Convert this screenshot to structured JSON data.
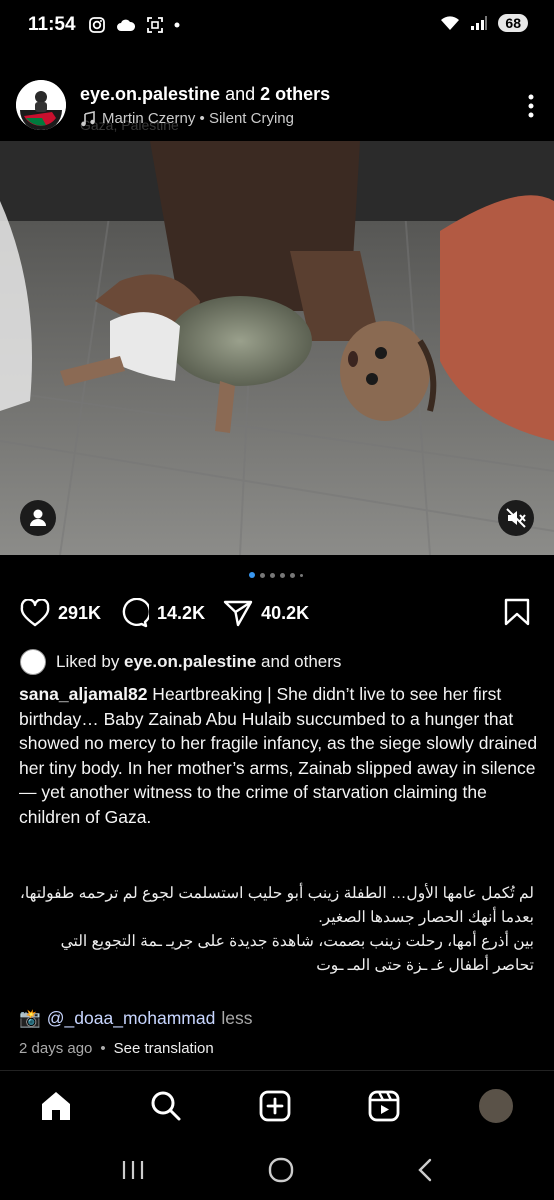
{
  "status_bar": {
    "time": "11:54",
    "battery": "68"
  },
  "post": {
    "author": "eye.on.palestine",
    "author_suffix": " and ",
    "others": "2 others",
    "music": "Martin Czerny • Silent Crying",
    "location": "Gaza, Palestine",
    "carousel_count": 6,
    "carousel_active": 0
  },
  "actions": {
    "likes": "291K",
    "comments": "14.2K",
    "shares": "40.2K"
  },
  "liked_by": {
    "prefix": "Liked by ",
    "user": "eye.on.palestine",
    "suffix": " and others"
  },
  "caption": {
    "username": "sana_aljamal82",
    "text": " Heartbreaking | She didn’t live to see her first birthday… Baby Zainab Abu Hulaib succumbed to a hunger that showed no mercy to her fragile infancy, as the siege slowly drained her tiny body. In her mother’s arms, Zainab slipped away in silence — yet another witness to the crime of starvation claiming the children of Gaza.",
    "arabic_1": "لم تُكمل عامها الأول… الطفلة زينب أبو حليب استسلمت لجوع لم ترحمه طفولتها، بعدما أنهك الحصار جسدها الصغير.",
    "arabic_2": "بين أذرع أمها، رحلت زينب بصمت، شاهدة جديدة على جريـ ـمة التجويع التي تحاصر أطفال غـ ـزة حتى المـ ـوت",
    "camera_emoji": "📸",
    "credit_mention": "@_doaa_mohammad",
    "less": "less"
  },
  "meta": {
    "time_ago": "2 days ago",
    "separator": "•",
    "see_translation": "See translation"
  },
  "colors": {
    "accent": "#3897f0",
    "background": "#000000"
  }
}
